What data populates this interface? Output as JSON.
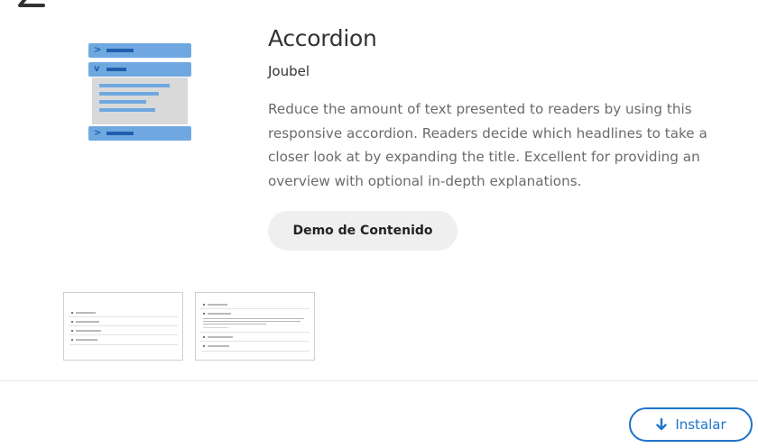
{
  "content_type": {
    "title": "Accordion",
    "author": "Joubel",
    "description": "Reduce the amount of text presented to readers by using this responsive accordion. Readers decide which headlines to take a closer look at by expanding the title. Excellent for providing an overview with optional in-depth explanations."
  },
  "buttons": {
    "demo_label": "Demo de Contenido",
    "install_label": "Instalar"
  },
  "icons": {
    "back": "back-arrow-icon",
    "install": "download-arrow-icon",
    "content_type": "accordion-icon"
  },
  "colors": {
    "accent": "#1f74c9",
    "icon_light": "#6fa8e0",
    "icon_dark": "#1f5fad"
  }
}
